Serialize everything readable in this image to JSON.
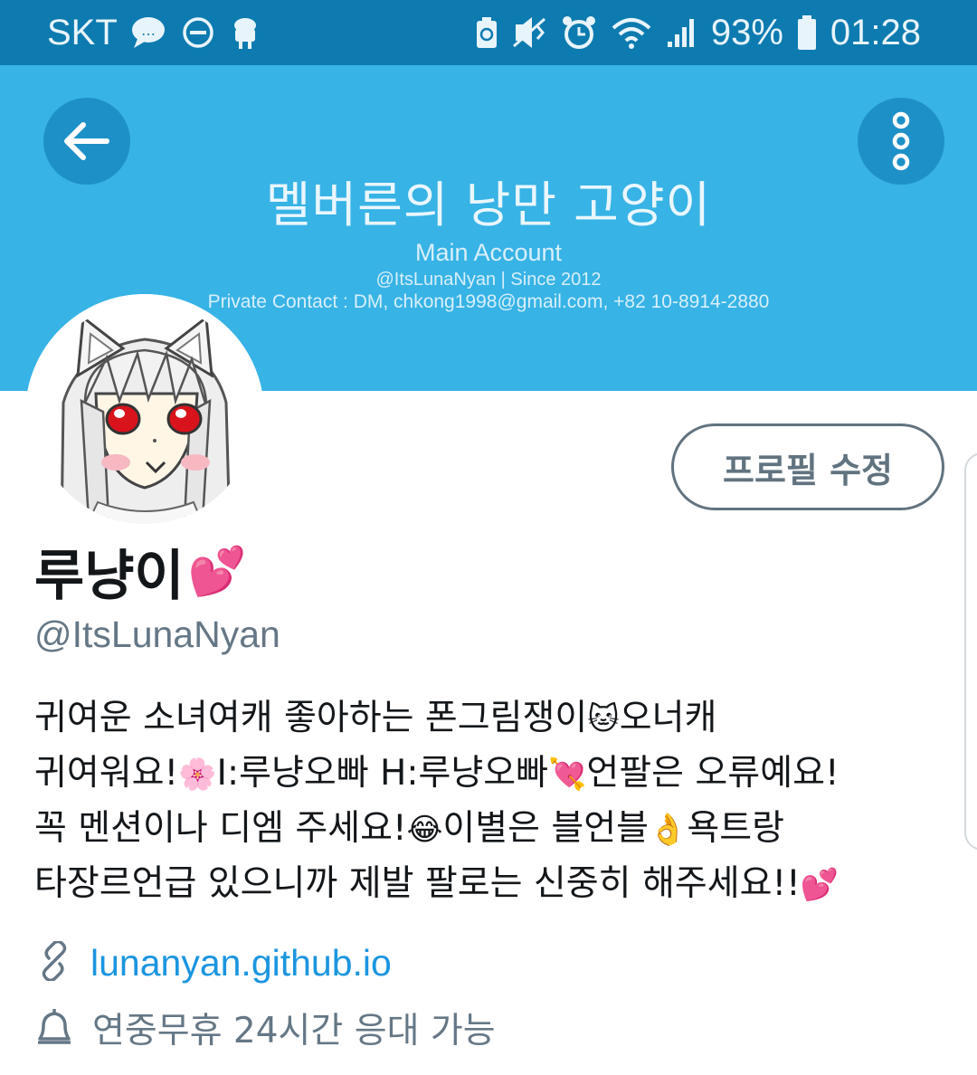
{
  "status_bar": {
    "carrier": "SKT",
    "battery": "93%",
    "time": "01:28",
    "icons": [
      "chat-bubble-icon",
      "do-not-disturb-icon",
      "android-icon",
      "recycle-battery-icon",
      "vibrate-icon",
      "alarm-icon",
      "wifi-icon",
      "signal-icon",
      "battery-icon"
    ]
  },
  "header": {
    "banner_title": "멜버른의 낭만 고양이",
    "banner_line1": "Main Account",
    "banner_line2": "@ItsLunaNyan | Since 2012",
    "banner_line3": "Private Contact : DM, chkong1998@gmail.com, +82 10-8914-2880",
    "color": "#37b3e6"
  },
  "profile": {
    "edit_button": "프로필 수정",
    "display_name": "루냥이",
    "display_name_emoji": "💕",
    "handle": "@ItsLunaNyan",
    "bio": [
      {
        "text": "귀여운 소녀여캐 좋아하는 폰그림쟁이",
        "emoji": "🐱",
        "after": "오너캐"
      },
      {
        "text": "귀여워요!",
        "emoji": "🌸",
        "after": "I:루냥오빠 H:루냥오빠",
        "emoji2": "💘",
        "after2": "언팔은 오류예요!"
      },
      {
        "text": "꼭 멘션이나 디엠 주세요!",
        "emoji": "😂",
        "after": "이별은 블언블",
        "emoji2": "👌",
        "after2": "욕트랑"
      },
      {
        "text": "타장르언급 있으니까 제발 팔로는 신중히 해주세요!!",
        "emoji": "💕"
      }
    ],
    "website": "lunanyan.github.io",
    "birthday_or_location": "연중무휴 24시간 응대 가능"
  }
}
